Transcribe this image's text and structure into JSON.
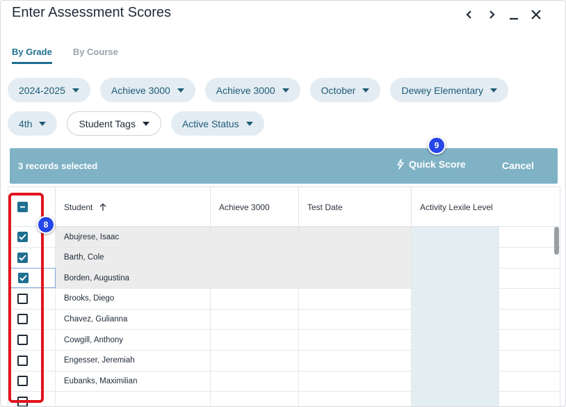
{
  "window": {
    "title": "Enter Assessment Scores",
    "controls": {
      "prev": "‹",
      "next": "›",
      "minimize": "_",
      "close": "✕"
    }
  },
  "tabs": [
    {
      "label": "By Grade",
      "active": true
    },
    {
      "label": "By Course",
      "active": false
    }
  ],
  "filters": {
    "row1": [
      "2024-2025",
      "Achieve 3000",
      "Achieve 3000",
      "October",
      "Dewey Elementary"
    ],
    "row2": [
      "4th",
      "Student Tags",
      "Active Status"
    ]
  },
  "action_bar": {
    "selected_text": "3 records selected",
    "quick_score_label": "Quick Score",
    "cancel_label": "Cancel"
  },
  "badges": {
    "checkbox_step": "8",
    "quick_score_step": "9"
  },
  "table": {
    "columns": [
      "Student",
      "Achieve 3000",
      "Test Date",
      "Activity Lexile Level"
    ],
    "rows": [
      {
        "student": "Abujrese, Isaac",
        "checked": true
      },
      {
        "student": "Barth, Cole",
        "checked": true
      },
      {
        "student": "Borden, Augustina",
        "checked": true
      },
      {
        "student": "Brooks, Diego",
        "checked": false
      },
      {
        "student": "Chavez, Gulianna",
        "checked": false
      },
      {
        "student": "Cowgill, Anthony",
        "checked": false
      },
      {
        "student": "Engesser, Jeremiah",
        "checked": false
      },
      {
        "student": "Eubanks, Maximilian",
        "checked": false
      },
      {
        "student": "",
        "checked": false
      }
    ]
  },
  "colors": {
    "accent": "#1e6f91",
    "action_bar": "#7fb2c5",
    "pill": "#e3ecf2",
    "badge": "#2546e8",
    "highlight_box": "#e1141e"
  },
  "icons": {
    "sort": "arrow-up-icon",
    "quick_score": "lightning-icon",
    "window": [
      "chevron-left-icon",
      "chevron-right-icon",
      "minimize-icon",
      "close-icon"
    ]
  }
}
